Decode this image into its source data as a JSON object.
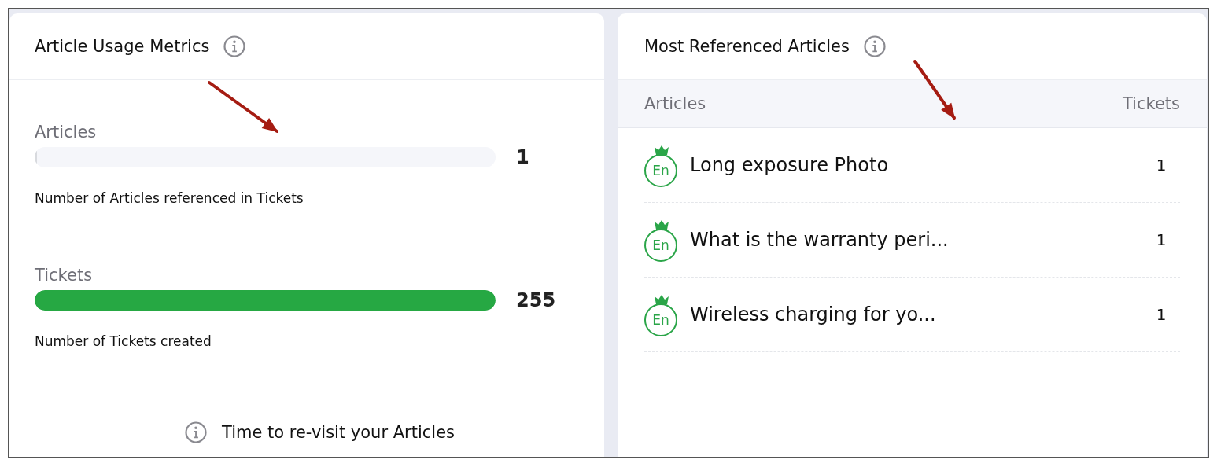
{
  "usage_panel": {
    "title": "Article Usage Metrics",
    "metrics": [
      {
        "label": "Articles",
        "level": 0.004,
        "value": "1",
        "description": "Number of Articles referenced in Tickets"
      },
      {
        "label": "Tickets",
        "level": 1,
        "value": "255",
        "description": "Number of Tickets created"
      }
    ],
    "footer": "Time to re-visit your Articles"
  },
  "referenced_panel": {
    "title": "Most Referenced Articles",
    "columns": [
      "Articles",
      "Tickets"
    ],
    "rows": [
      {
        "language": "En",
        "title": "Long exposure Photo",
        "tickets": "1"
      },
      {
        "language": "En",
        "title": "What is the warranty peri...",
        "tickets": "1"
      },
      {
        "language": "En",
        "title": "Wireless charging for yo...",
        "tickets": "1"
      }
    ]
  }
}
